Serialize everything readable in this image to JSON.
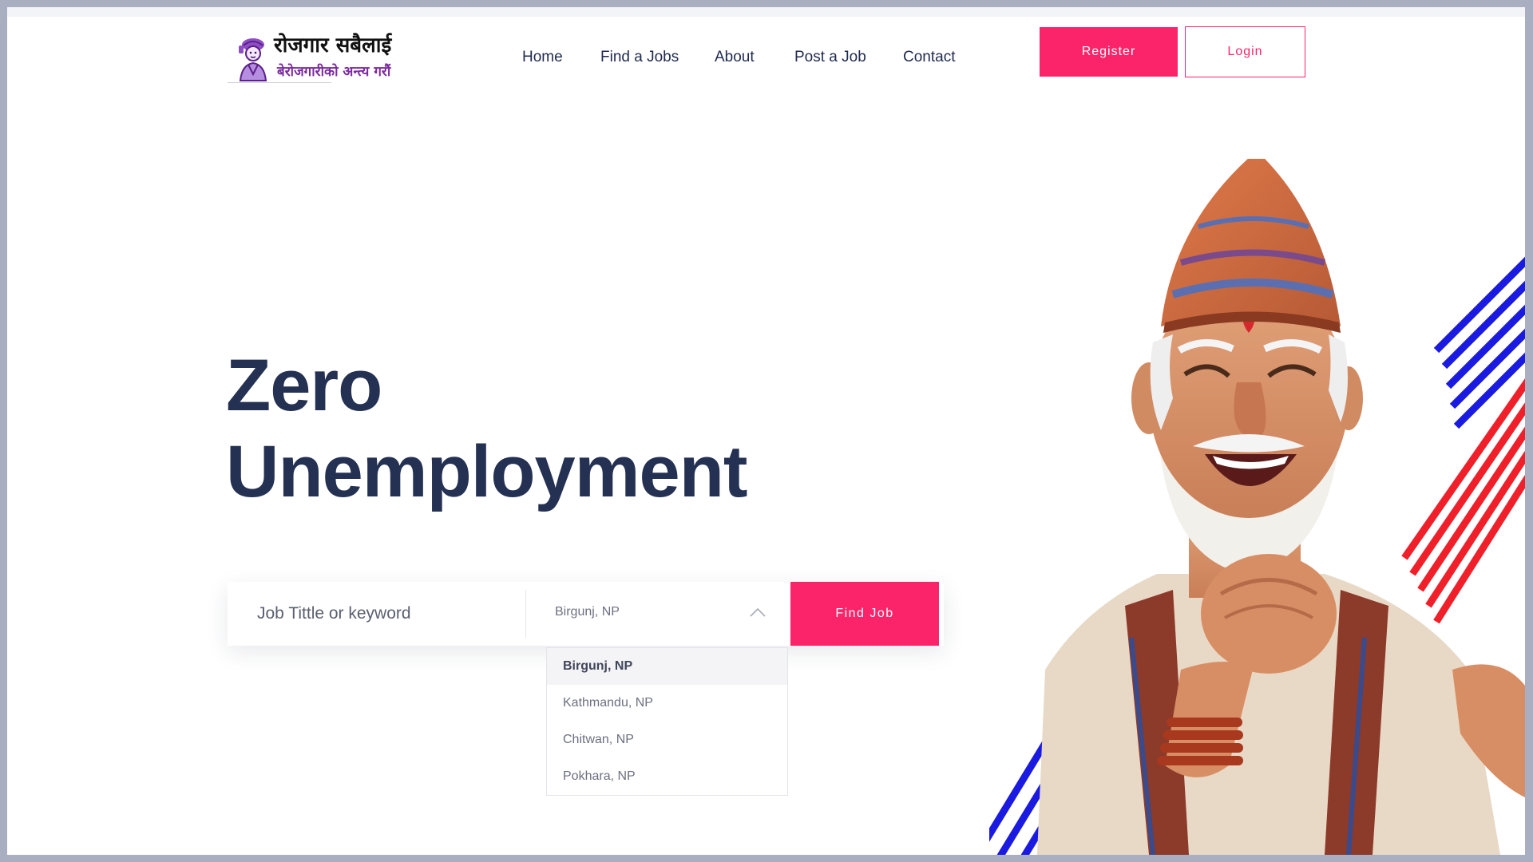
{
  "brand": {
    "title": "रोजगार सबैलाई",
    "tagline": "बेरोजगारीको अन्त्य गरौं"
  },
  "nav": {
    "items": [
      "Home",
      "Find a Jobs",
      "About",
      "Post a Job",
      "Contact"
    ]
  },
  "auth": {
    "register_label": "Register",
    "login_label": "Login"
  },
  "hero": {
    "title_line1": "Zero",
    "title_line2": "Unemployment"
  },
  "search": {
    "keyword_placeholder": "Job Tittle or keyword",
    "location_value": "Birgunj, NP",
    "button_label": "Find Job",
    "location_options": [
      "Birgunj, NP",
      "Kathmandu, NP",
      "Chitwan, NP",
      "Pokhara, NP"
    ],
    "selected_index": 0
  },
  "colors": {
    "accent": "#fb246a",
    "heading": "#253152",
    "nav_text": "#1f2a4e",
    "stripe_blue": "#1a1ae0",
    "stripe_red": "#f0202a"
  },
  "icons": {
    "logo": "worker-figure-icon",
    "select_toggle": "chevron-up-icon"
  }
}
